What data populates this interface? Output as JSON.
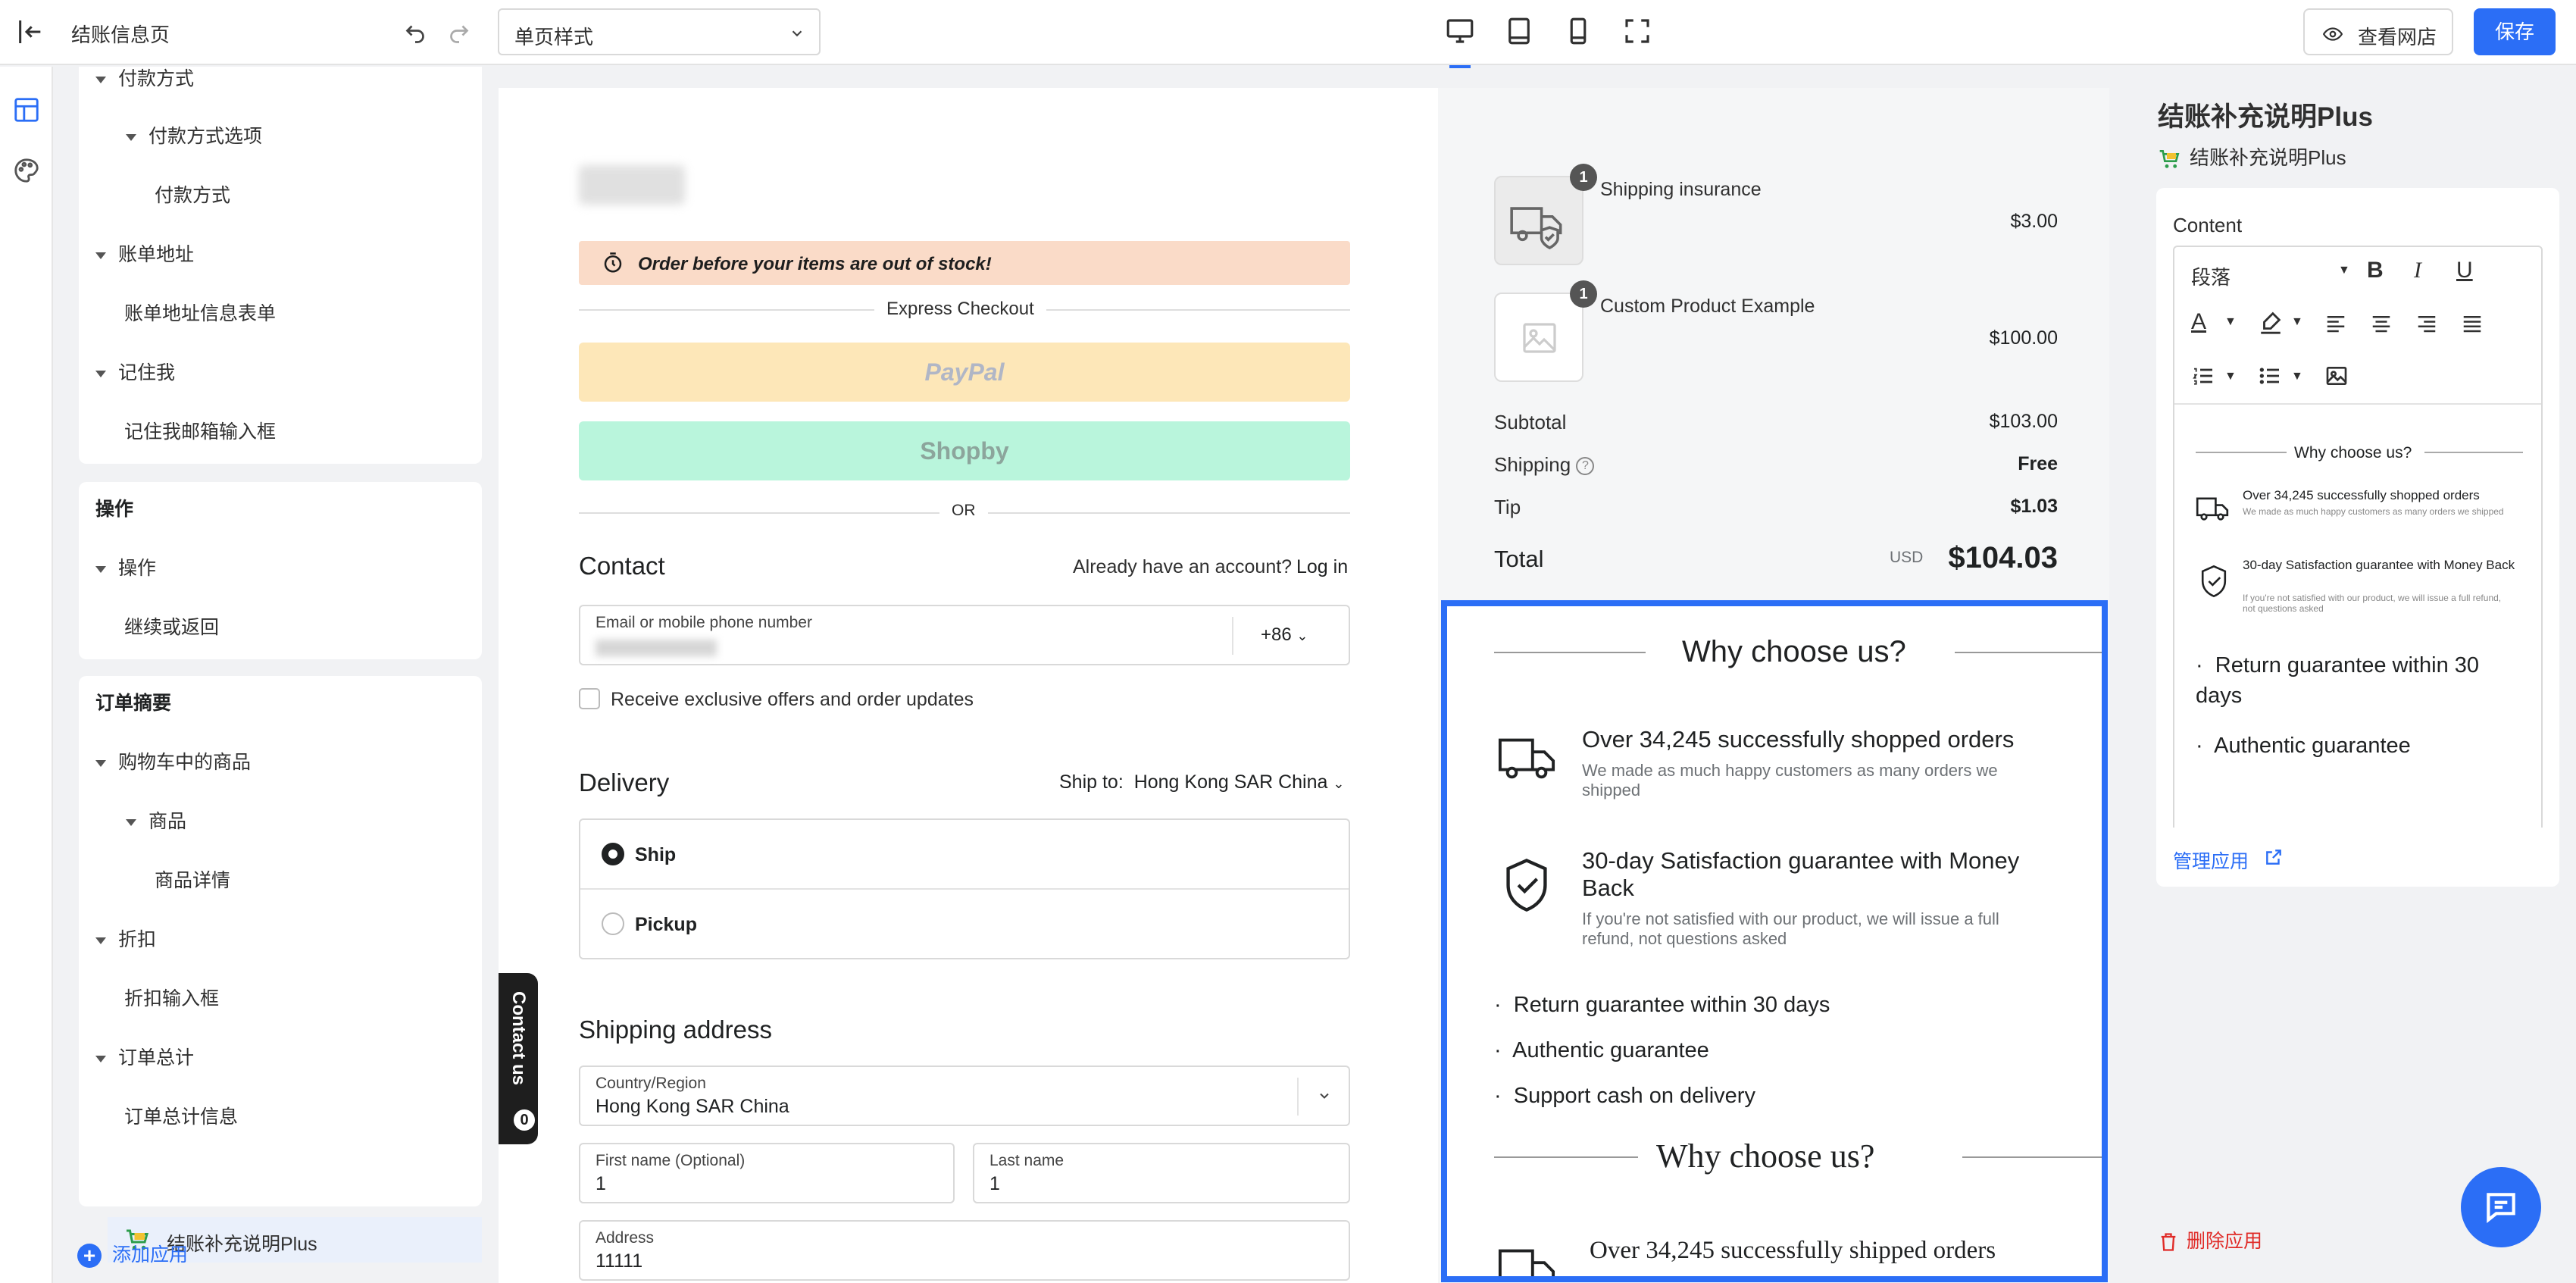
{
  "topbar": {
    "title": "结账信息页",
    "page_style": "单页样式",
    "view_store": "查看网店",
    "save": "保存"
  },
  "tree": {
    "payment_method": "付款方式",
    "payment_options": "付款方式选项",
    "payment_item": "付款方式",
    "billing_address": "账单地址",
    "billing_form": "账单地址信息表单",
    "remember_me": "记住我",
    "remember_email": "记住我邮箱输入框",
    "actions_section": "操作",
    "actions": "操作",
    "continue_back": "继续或返回",
    "order_summary_section": "订单摘要",
    "cart_items": "购物车中的商品",
    "products": "商品",
    "product_details": "商品详情",
    "discount": "折扣",
    "discount_input": "折扣输入框",
    "order_total": "订单总计",
    "order_total_info": "订单总计信息",
    "selected_app": "结账补充说明Plus",
    "add_app": "添加应用"
  },
  "checkout": {
    "stock_banner": "Order before your items are out of stock!",
    "express": "Express Checkout",
    "paypal": "PayPal",
    "shopby": "Shopby",
    "or": "OR",
    "contact_title": "Contact",
    "have_account": "Already have an account?",
    "login": "Log in",
    "email_label": "Email or mobile phone number",
    "phone_code": "+86",
    "offers": "Receive exclusive offers and order updates",
    "delivery_title": "Delivery",
    "ship_to_label": "Ship to:",
    "ship_to_value": "Hong Kong SAR China",
    "ship": "Ship",
    "pickup": "Pickup",
    "shipping_address_title": "Shipping address",
    "country_label": "Country/Region",
    "country_value": "Hong Kong SAR China",
    "first_name_label": "First name (Optional)",
    "first_name_value": "1",
    "last_name_label": "Last name",
    "last_name_value": "1",
    "address_label": "Address",
    "address_value": "11111",
    "contact_us": "Contact us",
    "contact_count": "0"
  },
  "summary": {
    "item1_qty": "1",
    "item1_name": "Shipping insurance",
    "item1_price": "$3.00",
    "item2_qty": "1",
    "item2_name": "Custom Product Example",
    "item2_price": "$100.00",
    "subtotal_label": "Subtotal",
    "subtotal": "$103.00",
    "shipping_label": "Shipping",
    "shipping": "Free",
    "tip_label": "Tip",
    "tip": "$1.03",
    "total_label": "Total",
    "currency": "USD",
    "total": "$104.03"
  },
  "why": {
    "title": "Why choose us?",
    "f1_title": "Over 34,245 successfully shopped orders",
    "f1_sub": "We made as much happy customers as many orders we shipped",
    "f2_title": "30-day Satisfaction guarantee with Money Back",
    "f2_sub": "If you're not satisfied with our product, we will issue a full refund, not questions asked",
    "b1": "Return guarantee within 30 days",
    "b2": "Authentic guarantee",
    "b3": "Support cash on delivery",
    "title2": "Why choose us?",
    "f3_title": "Over 34,245 successfully shipped orders"
  },
  "rightpanel": {
    "title": "结账补充说明Plus",
    "subtitle": "结账补充说明Plus",
    "content_label": "Content",
    "paragraph_select": "段落",
    "manage": "管理应用",
    "delete": "删除应用"
  },
  "editor": {
    "why": "Why choose us?",
    "f1_title": "Over 34,245 successfully shopped orders",
    "f1_sub": "We made as much happy customers as many orders we shipped",
    "f2_title": "30-day Satisfaction guarantee with Money Back",
    "f2_sub": "If you're not satisfied with our product, we will issue a full refund, not questions asked",
    "b1": "Return guarantee within 30 days",
    "b2": "Authentic guarantee"
  },
  "colors": {
    "accent": "#2b6ef6",
    "stock_banner": "#fadbc8",
    "paypal_bg": "#fde7b8",
    "shopby_bg": "#b9f5dc",
    "danger": "#e02b27"
  }
}
